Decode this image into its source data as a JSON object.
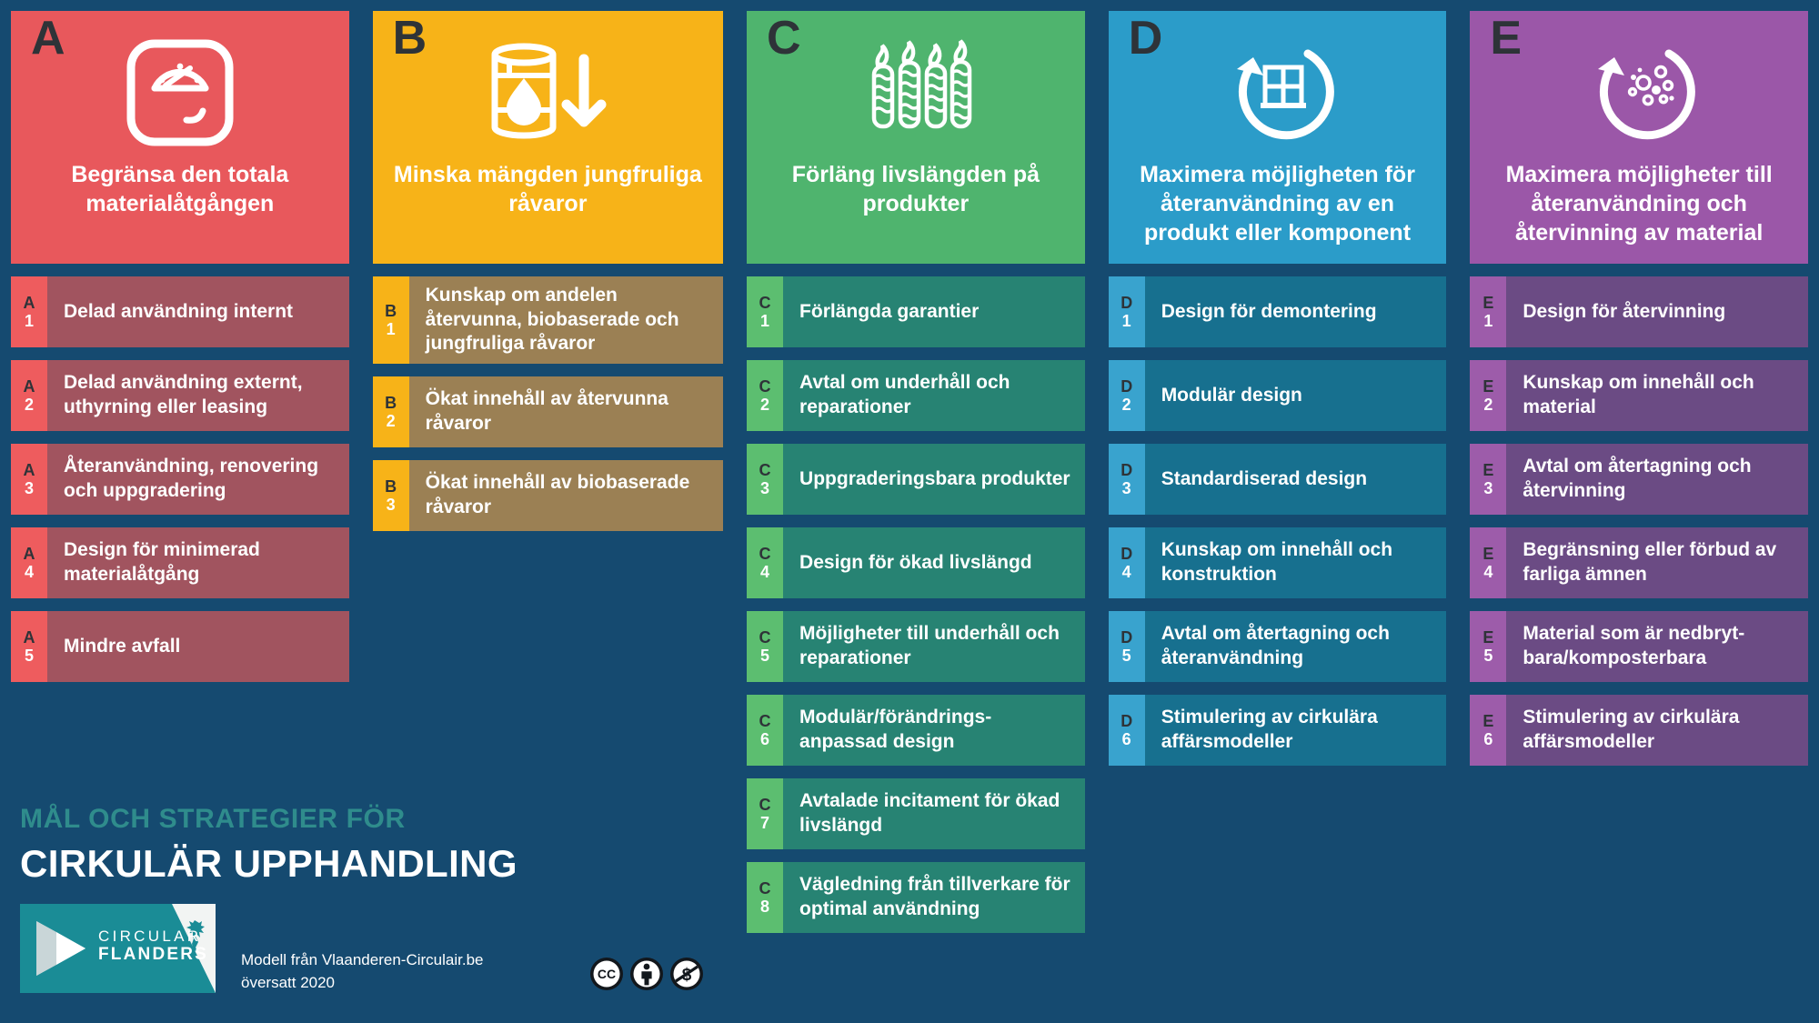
{
  "background_color": "#154A70",
  "columns": [
    {
      "letter": "A",
      "title": "Begränsa den totala materialåtgången",
      "icon": "bathroom-scale-icon",
      "header_color": "#E8585C",
      "tag_color": "#EE5C5E",
      "body_color": "#A1545F",
      "items": [
        {
          "letter": "A",
          "number": "1",
          "text": "Delad användning internt"
        },
        {
          "letter": "A",
          "number": "2",
          "text": "Delad användning externt, uthyrning eller leasing"
        },
        {
          "letter": "A",
          "number": "3",
          "text": "Återanvändning, renovering och uppgradering"
        },
        {
          "letter": "A",
          "number": "4",
          "text": "Design för minimerad materialåtgång"
        },
        {
          "letter": "A",
          "number": "5",
          "text": "Mindre avfall"
        }
      ]
    },
    {
      "letter": "B",
      "title": "Minska mängden jungfruliga råvaror",
      "icon": "oil-barrel-droplet-down-arrow-icon",
      "header_color": "#F7B318",
      "tag_color": "#F7B318",
      "body_color": "#9B8054",
      "items": [
        {
          "letter": "B",
          "number": "1",
          "text": "Kunskap om andelen återvunna, biobaserade och jungfruliga råvaror"
        },
        {
          "letter": "B",
          "number": "2",
          "text": "Ökat innehåll av återvunna råvaror"
        },
        {
          "letter": "B",
          "number": "3",
          "text": "Ökat innehåll av biobaserade råvaror"
        }
      ]
    },
    {
      "letter": "C",
      "title": "Förläng livslängden på produkter",
      "icon": "four-candles-icon",
      "header_color": "#4FB46E",
      "tag_color": "#5CBE70",
      "body_color": "#278373",
      "items": [
        {
          "letter": "C",
          "number": "1",
          "text": "Förlängda garantier"
        },
        {
          "letter": "C",
          "number": "2",
          "text": "Avtal om underhåll och reparationer"
        },
        {
          "letter": "C",
          "number": "3",
          "text": "Uppgraderingsbara produkter"
        },
        {
          "letter": "C",
          "number": "4",
          "text": "Design för ökad livslängd"
        },
        {
          "letter": "C",
          "number": "5",
          "text": "Möjligheter till underhåll och reparationer"
        },
        {
          "letter": "C",
          "number": "6",
          "text": "Modulär/förändrings-anpassad design"
        },
        {
          "letter": "C",
          "number": "7",
          "text": "Avtalade incitament för ökad livslängd"
        },
        {
          "letter": "C",
          "number": "8",
          "text": "Vägledning från tillverkare för optimal användning"
        }
      ]
    },
    {
      "letter": "D",
      "title": "Maximera möjligheten för återanvändning av en produkt eller komponent",
      "icon": "circular-arrow-window-icon",
      "header_color": "#2B9CC9",
      "tag_color": "#39A3CE",
      "body_color": "#17708F",
      "items": [
        {
          "letter": "D",
          "number": "1",
          "text": "Design för demontering"
        },
        {
          "letter": "D",
          "number": "2",
          "text": "Modulär design"
        },
        {
          "letter": "D",
          "number": "3",
          "text": "Standardiserad design"
        },
        {
          "letter": "D",
          "number": "4",
          "text": "Kunskap om innehåll och konstruktion"
        },
        {
          "letter": "D",
          "number": "5",
          "text": "Avtal om återtagning och återanvändning"
        },
        {
          "letter": "D",
          "number": "6",
          "text": "Stimulering av cirkulära affärsmodeller"
        }
      ]
    },
    {
      "letter": "E",
      "title": "Maximera möjligheter till återanvändning och återvinning av material",
      "icon": "circular-arrow-particles-icon",
      "header_color": "#9B57A8",
      "tag_color": "#9D5CAA",
      "body_color": "#6B4B84",
      "items": [
        {
          "letter": "E",
          "number": "1",
          "text": "Design för återvinning"
        },
        {
          "letter": "E",
          "number": "2",
          "text": "Kunskap om innehåll och material"
        },
        {
          "letter": "E",
          "number": "3",
          "text": "Avtal om återtagning och återvinning"
        },
        {
          "letter": "E",
          "number": "4",
          "text": "Begränsning eller förbud av farliga ämnen"
        },
        {
          "letter": "E",
          "number": "5",
          "text": "Material som är nedbryt-bara/komposterbara"
        },
        {
          "letter": "E",
          "number": "6",
          "text": "Stimulering av cirkulära affärsmodeller"
        }
      ]
    }
  ],
  "branding": {
    "kicker": "MÅL OCH STRATEGIER FÖR",
    "title": "CIRKULÄR UPPHANDLING",
    "kicker_color": "#2F8C8C",
    "logo": {
      "line1": "CIRCULAR",
      "line2": "FLANDERS",
      "color": "#1A8C96"
    },
    "credit_line1": "Modell från Vlaanderen-Circulair.be",
    "credit_line2": "översatt 2020",
    "licence_icons": [
      "creative-commons-icon",
      "attribution-icon",
      "noncommercial-icon"
    ]
  }
}
